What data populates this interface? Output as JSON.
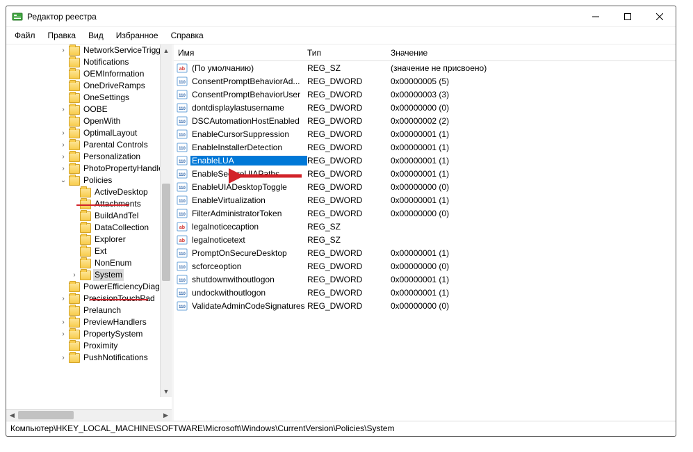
{
  "window": {
    "title": "Редактор реестра"
  },
  "menu": {
    "file": "Файл",
    "edit": "Правка",
    "view": "Вид",
    "favorites": "Избранное",
    "help": "Справка"
  },
  "tree": {
    "items": [
      {
        "indent": 4,
        "exp": ">",
        "label": "NetworkServiceTrigge"
      },
      {
        "indent": 4,
        "exp": "",
        "label": "Notifications"
      },
      {
        "indent": 4,
        "exp": "",
        "label": "OEMInformation"
      },
      {
        "indent": 4,
        "exp": "",
        "label": "OneDriveRamps"
      },
      {
        "indent": 4,
        "exp": "",
        "label": "OneSettings"
      },
      {
        "indent": 4,
        "exp": ">",
        "label": "OOBE"
      },
      {
        "indent": 4,
        "exp": "",
        "label": "OpenWith"
      },
      {
        "indent": 4,
        "exp": ">",
        "label": "OptimalLayout"
      },
      {
        "indent": 4,
        "exp": ">",
        "label": "Parental Controls"
      },
      {
        "indent": 4,
        "exp": ">",
        "label": "Personalization"
      },
      {
        "indent": 4,
        "exp": ">",
        "label": "PhotoPropertyHandle"
      },
      {
        "indent": 4,
        "exp": "v",
        "label": "Policies",
        "underline": true
      },
      {
        "indent": 5,
        "exp": "",
        "label": "ActiveDesktop"
      },
      {
        "indent": 5,
        "exp": "",
        "label": "Attachments"
      },
      {
        "indent": 5,
        "exp": "",
        "label": "BuildAndTel"
      },
      {
        "indent": 5,
        "exp": "",
        "label": "DataCollection"
      },
      {
        "indent": 5,
        "exp": "",
        "label": "Explorer"
      },
      {
        "indent": 5,
        "exp": "",
        "label": "Ext"
      },
      {
        "indent": 5,
        "exp": "",
        "label": "NonEnum"
      },
      {
        "indent": 5,
        "exp": ">",
        "label": "System",
        "selected": true,
        "underline": true
      },
      {
        "indent": 4,
        "exp": "",
        "label": "PowerEfficiencyDiagn"
      },
      {
        "indent": 4,
        "exp": ">",
        "label": "PrecisionTouchPad"
      },
      {
        "indent": 4,
        "exp": "",
        "label": "Prelaunch"
      },
      {
        "indent": 4,
        "exp": ">",
        "label": "PreviewHandlers"
      },
      {
        "indent": 4,
        "exp": ">",
        "label": "PropertySystem"
      },
      {
        "indent": 4,
        "exp": "",
        "label": "Proximity"
      },
      {
        "indent": 4,
        "exp": ">",
        "label": "PushNotifications"
      }
    ]
  },
  "list": {
    "header": {
      "name": "Имя",
      "type": "Тип",
      "value": "Значение"
    },
    "rows": [
      {
        "icon": "sz",
        "name": "(По умолчанию)",
        "type": "REG_SZ",
        "value": "(значение не присвоено)"
      },
      {
        "icon": "bin",
        "name": "ConsentPromptBehaviorAd...",
        "type": "REG_DWORD",
        "value": "0x00000005 (5)"
      },
      {
        "icon": "bin",
        "name": "ConsentPromptBehaviorUser",
        "type": "REG_DWORD",
        "value": "0x00000003 (3)"
      },
      {
        "icon": "bin",
        "name": "dontdisplaylastusername",
        "type": "REG_DWORD",
        "value": "0x00000000 (0)"
      },
      {
        "icon": "bin",
        "name": "DSCAutomationHostEnabled",
        "type": "REG_DWORD",
        "value": "0x00000002 (2)"
      },
      {
        "icon": "bin",
        "name": "EnableCursorSuppression",
        "type": "REG_DWORD",
        "value": "0x00000001 (1)"
      },
      {
        "icon": "bin",
        "name": "EnableInstallerDetection",
        "type": "REG_DWORD",
        "value": "0x00000001 (1)"
      },
      {
        "icon": "bin",
        "name": "EnableLUA",
        "type": "REG_DWORD",
        "value": "0x00000001 (1)",
        "selected": true
      },
      {
        "icon": "bin",
        "name": "EnableSecureUIAPaths",
        "type": "REG_DWORD",
        "value": "0x00000001 (1)"
      },
      {
        "icon": "bin",
        "name": "EnableUIADesktopToggle",
        "type": "REG_DWORD",
        "value": "0x00000000 (0)"
      },
      {
        "icon": "bin",
        "name": "EnableVirtualization",
        "type": "REG_DWORD",
        "value": "0x00000001 (1)"
      },
      {
        "icon": "bin",
        "name": "FilterAdministratorToken",
        "type": "REG_DWORD",
        "value": "0x00000000 (0)"
      },
      {
        "icon": "sz",
        "name": "legalnoticecaption",
        "type": "REG_SZ",
        "value": ""
      },
      {
        "icon": "sz",
        "name": "legalnoticetext",
        "type": "REG_SZ",
        "value": ""
      },
      {
        "icon": "bin",
        "name": "PromptOnSecureDesktop",
        "type": "REG_DWORD",
        "value": "0x00000001 (1)"
      },
      {
        "icon": "bin",
        "name": "scforceoption",
        "type": "REG_DWORD",
        "value": "0x00000000 (0)"
      },
      {
        "icon": "bin",
        "name": "shutdownwithoutlogon",
        "type": "REG_DWORD",
        "value": "0x00000001 (1)"
      },
      {
        "icon": "bin",
        "name": "undockwithoutlogon",
        "type": "REG_DWORD",
        "value": "0x00000001 (1)"
      },
      {
        "icon": "bin",
        "name": "ValidateAdminCodeSignatures",
        "type": "REG_DWORD",
        "value": "0x00000000 (0)"
      }
    ]
  },
  "statusbar": {
    "path": "Компьютер\\HKEY_LOCAL_MACHINE\\SOFTWARE\\Microsoft\\Windows\\CurrentVersion\\Policies\\System"
  }
}
